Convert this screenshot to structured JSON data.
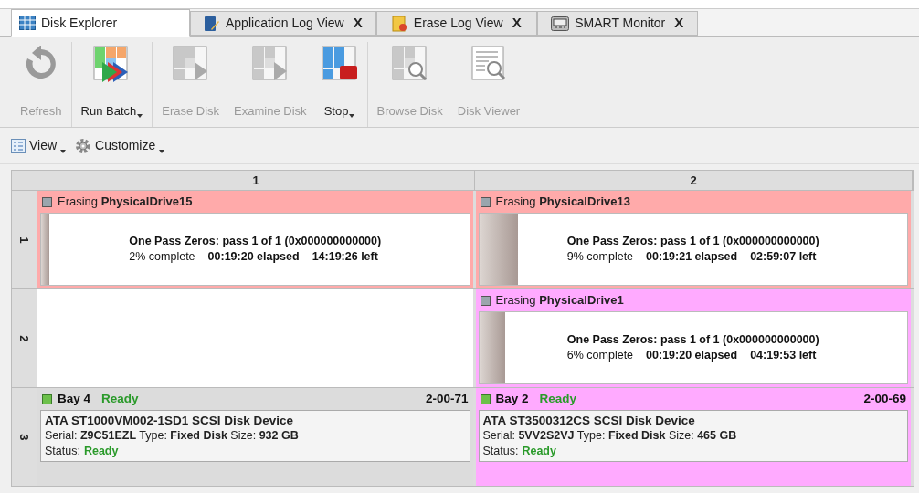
{
  "tabs": [
    {
      "label": "Disk Explorer",
      "kind": "grid",
      "selected": true
    },
    {
      "label": "Application Log View",
      "kind": "log",
      "selected": false,
      "close": "X"
    },
    {
      "label": "Erase Log View",
      "kind": "erase-log",
      "selected": false,
      "close": "X"
    },
    {
      "label": "SMART Monitor",
      "kind": "monitor",
      "selected": false,
      "close": "X"
    }
  ],
  "toolbar": {
    "groups": [
      [
        {
          "label": "Refresh",
          "kind": "refresh",
          "disabled": true,
          "dropdown": false
        }
      ],
      [
        {
          "label": "Run Batch",
          "kind": "run",
          "disabled": false,
          "dropdown": true
        }
      ],
      [
        {
          "label": "Erase Disk",
          "kind": "play",
          "disabled": true,
          "dropdown": false
        },
        {
          "label": "Examine Disk",
          "kind": "play",
          "disabled": true,
          "dropdown": false
        },
        {
          "label": "Stop",
          "kind": "stop",
          "disabled": false,
          "dropdown": true
        }
      ],
      [
        {
          "label": "Browse Disk",
          "kind": "browse",
          "disabled": true,
          "dropdown": false
        },
        {
          "label": "Disk Viewer",
          "kind": "viewer",
          "disabled": true,
          "dropdown": false
        }
      ]
    ]
  },
  "view_bar": [
    {
      "label": "View",
      "kind": "view",
      "dropdown": true
    },
    {
      "label": "Customize",
      "kind": "gear",
      "dropdown": true
    }
  ],
  "grid": {
    "columns": [
      "1",
      "2"
    ],
    "rows": [
      {
        "label": "1",
        "cells": [
          {
            "kind": "erasing",
            "color": "#ffaaaa",
            "title": "Erasing **PhysicalDrive15**",
            "line1": "One Pass Zeros: pass 1 of 1 (0x000000000000)",
            "complete": "2% complete",
            "elapsed": "00:19:20 elapsed",
            "left": "14:19:26 left",
            "level": 0.02
          },
          {
            "kind": "erasing",
            "color": "#ffaaaa",
            "title": "Erasing **PhysicalDrive13**",
            "line1": "One Pass Zeros: pass 1 of 1 (0x000000000000)",
            "complete": "9% complete",
            "elapsed": "00:19:21 elapsed",
            "left": "02:59:07 left",
            "level": 0.09
          }
        ]
      },
      {
        "label": "2",
        "cells": [
          {
            "kind": "empty"
          },
          {
            "kind": "erasing",
            "color": "#ffaaff",
            "title": "Erasing **PhysicalDrive1**",
            "line1": "One Pass Zeros: pass 1 of 1 (0x000000000000)",
            "complete": "6% complete",
            "elapsed": "00:19:20 elapsed",
            "left": "04:19:53 left",
            "level": 0.06
          }
        ]
      },
      {
        "label": "3",
        "cells": [
          {
            "kind": "bay",
            "color": "#dcdcdc",
            "bay": "Bay 4",
            "state": "Ready",
            "code": "2-00-71",
            "device": "ATA ST1000VM002-1SD1 SCSI Disk Device",
            "details": "Serial: **Z9C51EZL** Type: **Fixed Disk**  Size: **932 GB**",
            "status_label": "Status:",
            "status": "Ready"
          },
          {
            "kind": "bay",
            "color": "#ffaaff",
            "bay": "Bay 2",
            "state": "Ready",
            "code": "2-00-69",
            "device": "ATA ST3500312CS SCSI Disk Device",
            "details": "Serial: **5VV2S2VJ** Type: **Fixed Disk**  Size: **465 GB**",
            "status_label": "Status:",
            "status": "Ready"
          }
        ]
      }
    ]
  }
}
